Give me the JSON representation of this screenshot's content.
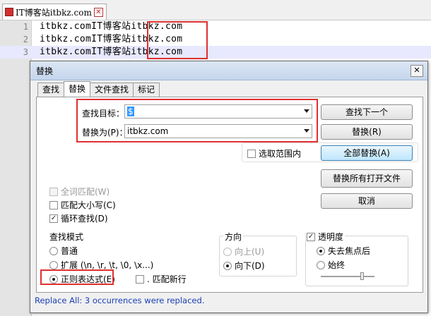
{
  "editor": {
    "tab_label": "IT博客站itbkz.com",
    "lines": [
      {
        "num": "1",
        "text": "itbkz.comIT博客站itbkz.com"
      },
      {
        "num": "2",
        "text": "itbkz.comIT博客站itbkz.com"
      },
      {
        "num": "3",
        "text": "itbkz.comIT博客站itbkz.com"
      }
    ]
  },
  "dialog": {
    "title": "替换",
    "close": "✕",
    "tabs": [
      "查找",
      "替换",
      "文件查找",
      "标记"
    ],
    "find_label": "查找目标：",
    "find_value": "$",
    "replace_label": "替换为(P)：",
    "replace_value": "itbkz.com",
    "buttons": {
      "find_next": "查找下一个",
      "replace": "替换(R)",
      "replace_all": "全部替换(A)",
      "replace_all_open": "替换所有打开文件",
      "cancel": "取消"
    },
    "in_selection": "选取范围内",
    "options": {
      "whole_word": "全词匹配(W)",
      "match_case": "匹配大小写(C)",
      "wrap": "循环查找(D)"
    },
    "search_mode": {
      "title": "查找模式",
      "normal": "普通",
      "extended": "扩展 (\\n, \\r, \\t, \\0, \\x...)",
      "regex": "正则表达式(E)",
      "dot_newline": ". 匹配新行"
    },
    "direction": {
      "title": "方向",
      "up": "向上(U)",
      "down": "向下(D)"
    },
    "transparency": {
      "title": "透明度",
      "on_lose_focus": "失去焦点后",
      "always": "始终"
    },
    "status": "Replace All: 3 occurrences were replaced."
  }
}
